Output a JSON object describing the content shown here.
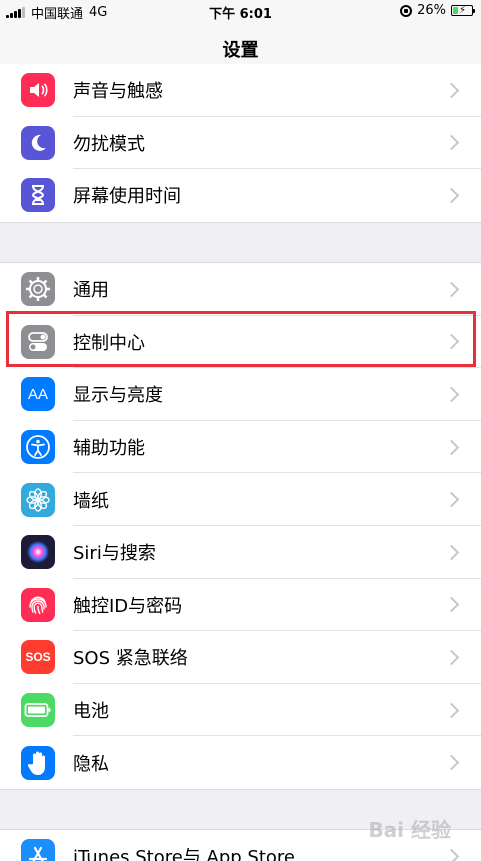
{
  "status": {
    "carrier": "中国联通",
    "network": "4G",
    "time": "下午 6:01",
    "battery": "26%",
    "battery_level": 0.26
  },
  "nav": {
    "title": "设置"
  },
  "group1": [
    {
      "label": "声音与触感",
      "icon": "speaker-icon",
      "color": "#ff2d55"
    },
    {
      "label": "勿扰模式",
      "icon": "moon-icon",
      "color": "#5856d6"
    },
    {
      "label": "屏幕使用时间",
      "icon": "hourglass-icon",
      "color": "#5856d6"
    }
  ],
  "group2": [
    {
      "label": "通用",
      "icon": "gear-icon",
      "color": "#8e8e93"
    },
    {
      "label": "控制中心",
      "icon": "toggles-icon",
      "color": "#8e8e93"
    },
    {
      "label": "显示与亮度",
      "icon": "text-size-icon",
      "color": "#007aff",
      "glyph": "AA"
    },
    {
      "label": "辅助功能",
      "icon": "accessibility-icon",
      "color": "#007aff"
    },
    {
      "label": "墙纸",
      "icon": "flower-icon",
      "color": "#34aadc"
    },
    {
      "label": "Siri与搜索",
      "icon": "siri-icon",
      "color": "#1c1c3a"
    },
    {
      "label": "触控ID与密码",
      "icon": "fingerprint-icon",
      "color": "#ff2d55"
    },
    {
      "label": "SOS 紧急联络",
      "icon": "sos-icon",
      "color": "#ff3b30",
      "glyph": "SOS"
    },
    {
      "label": "电池",
      "icon": "battery-icon",
      "color": "#4cd964"
    },
    {
      "label": "隐私",
      "icon": "hand-icon",
      "color": "#007aff"
    }
  ],
  "group3": [
    {
      "label": "iTunes Store与 App Store",
      "icon": "app-store-icon",
      "color": "#1c8ef9"
    }
  ],
  "watermark": "Bai 经验"
}
